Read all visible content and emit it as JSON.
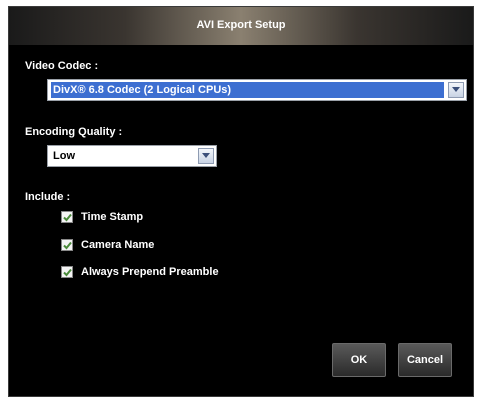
{
  "dialog": {
    "title": "AVI Export Setup"
  },
  "video_codec": {
    "label": "Video Codec :",
    "selected": "DivX® 6.8 Codec (2 Logical CPUs)"
  },
  "encoding_quality": {
    "label": "Encoding Quality :",
    "selected": "Low"
  },
  "include": {
    "label": "Include :",
    "options": [
      {
        "label": "Time Stamp",
        "checked": true
      },
      {
        "label": "Camera Name",
        "checked": true
      },
      {
        "label": "Always Prepend Preamble",
        "checked": true
      }
    ]
  },
  "buttons": {
    "ok": "OK",
    "cancel": "Cancel"
  },
  "colors": {
    "selection": "#3d6fd1",
    "check": "#4a8a3a"
  }
}
